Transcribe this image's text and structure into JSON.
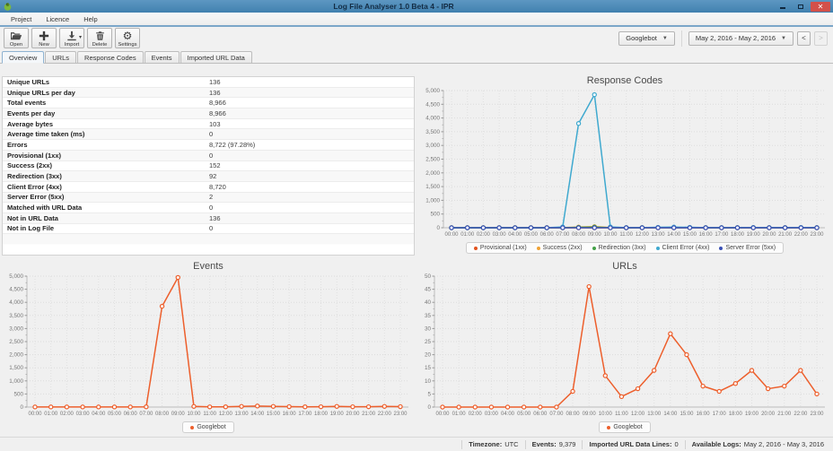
{
  "window": {
    "title": "Log File Analyser 1.0 Beta 4 - IPR"
  },
  "menu": {
    "items": [
      {
        "name": "menu-project",
        "label": "Project"
      },
      {
        "name": "menu-licence",
        "label": "Licence"
      },
      {
        "name": "menu-help",
        "label": "Help"
      }
    ]
  },
  "toolbar": {
    "buttons": [
      {
        "name": "open-button",
        "label": "Open",
        "icon": "open-folder-icon"
      },
      {
        "name": "new-button",
        "label": "New",
        "icon": "plus-icon"
      },
      {
        "name": "import-button",
        "label": "Import",
        "icon": "import-icon",
        "has_caret": true
      },
      {
        "name": "delete-button",
        "label": "Delete",
        "icon": "trash-icon"
      },
      {
        "name": "settings-button",
        "label": "Settings",
        "icon": "gear-icon"
      }
    ],
    "user_agent_dropdown": "Googlebot",
    "date_range_dropdown": "May 2, 2016 - May 2, 2016",
    "prev_label": "<",
    "next_label": ">"
  },
  "tabs": [
    {
      "name": "tab-overview",
      "label": "Overview",
      "active": true
    },
    {
      "name": "tab-urls",
      "label": "URLs"
    },
    {
      "name": "tab-response-codes",
      "label": "Response Codes"
    },
    {
      "name": "tab-events",
      "label": "Events"
    },
    {
      "name": "tab-imported-url-data",
      "label": "Imported URL Data"
    }
  ],
  "overview_table": {
    "rows": [
      {
        "label": "Unique URLs",
        "value": "136"
      },
      {
        "label": "Unique URLs per day",
        "value": "136"
      },
      {
        "label": "Total events",
        "value": "8,966"
      },
      {
        "label": "Events per day",
        "value": "8,966"
      },
      {
        "label": "Average bytes",
        "value": "103"
      },
      {
        "label": "Average time taken (ms)",
        "value": "0"
      },
      {
        "label": "Errors",
        "value": "8,722 (97.28%)"
      },
      {
        "label": "Provisional (1xx)",
        "value": "0"
      },
      {
        "label": "Success (2xx)",
        "value": "152"
      },
      {
        "label": "Redirection (3xx)",
        "value": "92"
      },
      {
        "label": "Client Error (4xx)",
        "value": "8,720"
      },
      {
        "label": "Server Error (5xx)",
        "value": "2"
      },
      {
        "label": "Matched with URL Data",
        "value": "0"
      },
      {
        "label": "Not in URL Data",
        "value": "136"
      },
      {
        "label": "Not in Log File",
        "value": "0"
      }
    ]
  },
  "chart_data": [
    {
      "name": "response-codes",
      "type": "line",
      "title": "Response Codes",
      "xlabel": "",
      "ylabel": "",
      "ylim": [
        0,
        5000
      ],
      "ytick_step": 500,
      "grid": true,
      "legend_position": "bottom",
      "categories": [
        "00:00",
        "01:00",
        "02:00",
        "03:00",
        "04:00",
        "05:00",
        "06:00",
        "07:00",
        "08:00",
        "09:00",
        "10:00",
        "11:00",
        "12:00",
        "13:00",
        "14:00",
        "15:00",
        "16:00",
        "17:00",
        "18:00",
        "19:00",
        "20:00",
        "21:00",
        "22:00",
        "23:00"
      ],
      "series": [
        {
          "name": "Provisional (1xx)",
          "color": "#e2531f",
          "values": [
            0,
            0,
            0,
            0,
            0,
            0,
            0,
            0,
            0,
            0,
            0,
            0,
            0,
            0,
            0,
            0,
            0,
            0,
            0,
            0,
            0,
            0,
            0,
            0
          ]
        },
        {
          "name": "Success (2xx)",
          "color": "#f0a233",
          "values": [
            3,
            3,
            3,
            3,
            3,
            3,
            3,
            5,
            25,
            40,
            10,
            3,
            4,
            8,
            10,
            8,
            4,
            3,
            4,
            6,
            4,
            4,
            6,
            4
          ]
        },
        {
          "name": "Redirection (3xx)",
          "color": "#43a047",
          "values": [
            2,
            2,
            2,
            2,
            2,
            2,
            2,
            3,
            15,
            25,
            6,
            2,
            3,
            5,
            6,
            5,
            3,
            2,
            3,
            4,
            3,
            3,
            4,
            3
          ]
        },
        {
          "name": "Client Error (4xx)",
          "color": "#3fa9cf",
          "values": [
            0,
            0,
            0,
            0,
            0,
            0,
            0,
            30,
            3800,
            4850,
            30,
            5,
            5,
            15,
            25,
            15,
            5,
            5,
            5,
            10,
            5,
            5,
            10,
            5
          ]
        },
        {
          "name": "Server Error (5xx)",
          "color": "#3a50b5",
          "values": [
            0,
            0,
            0,
            0,
            0,
            0,
            0,
            0,
            1,
            1,
            0,
            0,
            0,
            0,
            0,
            0,
            0,
            0,
            0,
            0,
            0,
            0,
            0,
            0
          ]
        }
      ]
    },
    {
      "name": "events",
      "type": "line",
      "title": "Events",
      "xlabel": "",
      "ylabel": "",
      "ylim": [
        0,
        5000
      ],
      "ytick_step": 500,
      "grid": true,
      "legend_position": "bottom",
      "categories": [
        "00:00",
        "01:00",
        "02:00",
        "03:00",
        "04:00",
        "05:00",
        "06:00",
        "07:00",
        "08:00",
        "09:00",
        "10:00",
        "11:00",
        "12:00",
        "13:00",
        "14:00",
        "15:00",
        "16:00",
        "17:00",
        "18:00",
        "19:00",
        "20:00",
        "21:00",
        "22:00",
        "23:00"
      ],
      "series": [
        {
          "name": "Googlebot",
          "color": "#ed5f2c",
          "values": [
            5,
            5,
            5,
            5,
            5,
            5,
            5,
            10,
            3850,
            4950,
            25,
            8,
            10,
            25,
            40,
            25,
            15,
            10,
            12,
            25,
            12,
            12,
            25,
            15
          ]
        }
      ]
    },
    {
      "name": "urls",
      "type": "line",
      "title": "URLs",
      "xlabel": "",
      "ylabel": "",
      "ylim": [
        0,
        50
      ],
      "ytick_step": 5,
      "grid": true,
      "legend_position": "bottom",
      "categories": [
        "00:00",
        "01:00",
        "02:00",
        "03:00",
        "04:00",
        "05:00",
        "06:00",
        "07:00",
        "08:00",
        "09:00",
        "10:00",
        "11:00",
        "12:00",
        "13:00",
        "14:00",
        "15:00",
        "16:00",
        "17:00",
        "18:00",
        "19:00",
        "20:00",
        "21:00",
        "22:00",
        "23:00"
      ],
      "series": [
        {
          "name": "Googlebot",
          "color": "#ed5f2c",
          "values": [
            0,
            0,
            0,
            0,
            0,
            0,
            0,
            0,
            6,
            46,
            12,
            4,
            7,
            14,
            28,
            20,
            8,
            6,
            9,
            14,
            7,
            8,
            14,
            5
          ]
        }
      ]
    }
  ],
  "status_bar": {
    "segments": [
      {
        "label": "Timezone:",
        "value": "UTC"
      },
      {
        "label": "Events:",
        "value": "9,379"
      },
      {
        "label": "Imported URL Data Lines:",
        "value": "0"
      },
      {
        "label": "Available Logs:",
        "value": "May 2, 2016 - May 3, 2016"
      }
    ]
  }
}
